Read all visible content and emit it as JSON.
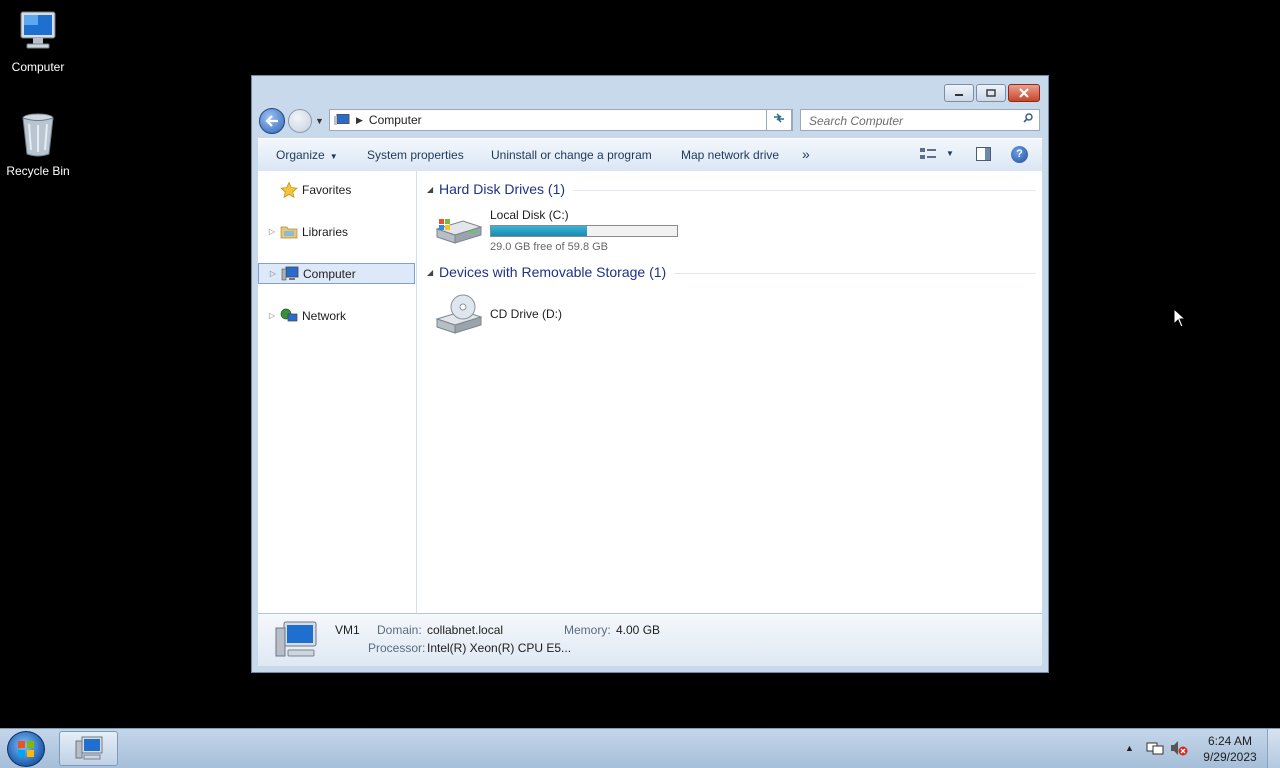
{
  "desktop": {
    "icons": [
      {
        "label": "Computer",
        "icon": "computer-icon"
      },
      {
        "label": "Recycle Bin",
        "icon": "recycle-bin-icon"
      }
    ]
  },
  "window": {
    "address": {
      "location": "Computer"
    },
    "search": {
      "placeholder": "Search Computer"
    },
    "toolbar": {
      "organize": "Organize",
      "system_properties": "System properties",
      "uninstall": "Uninstall or change a program",
      "map_drive": "Map network drive",
      "more": "»"
    },
    "nav_pane": {
      "items": [
        {
          "label": "Favorites",
          "icon": "star-icon"
        },
        {
          "label": "Libraries",
          "icon": "libraries-icon"
        },
        {
          "label": "Computer",
          "icon": "computer-icon",
          "selected": true
        },
        {
          "label": "Network",
          "icon": "network-icon"
        }
      ]
    },
    "groups": {
      "hdd": {
        "title": "Hard Disk Drives (1)",
        "drives": [
          {
            "label": "Local Disk (C:)",
            "free_text": "29.0 GB free of 59.8 GB",
            "used_fraction": 0.515
          }
        ]
      },
      "removable": {
        "title": "Devices with Removable Storage (1)",
        "drives": [
          {
            "label": "CD Drive (D:)"
          }
        ]
      }
    },
    "details": {
      "name": "VM1",
      "domain_label": "Domain:",
      "domain": "collabnet.local",
      "memory_label": "Memory:",
      "memory": "4.00 GB",
      "processor_label": "Processor:",
      "processor": "Intel(R) Xeon(R) CPU E5..."
    }
  },
  "taskbar": {
    "time": "6:24 AM",
    "date": "9/29/2023"
  },
  "colors": {
    "accent": "#1e3287",
    "selection": "#dde9f8",
    "drive_fill": "#1a8ab0"
  }
}
